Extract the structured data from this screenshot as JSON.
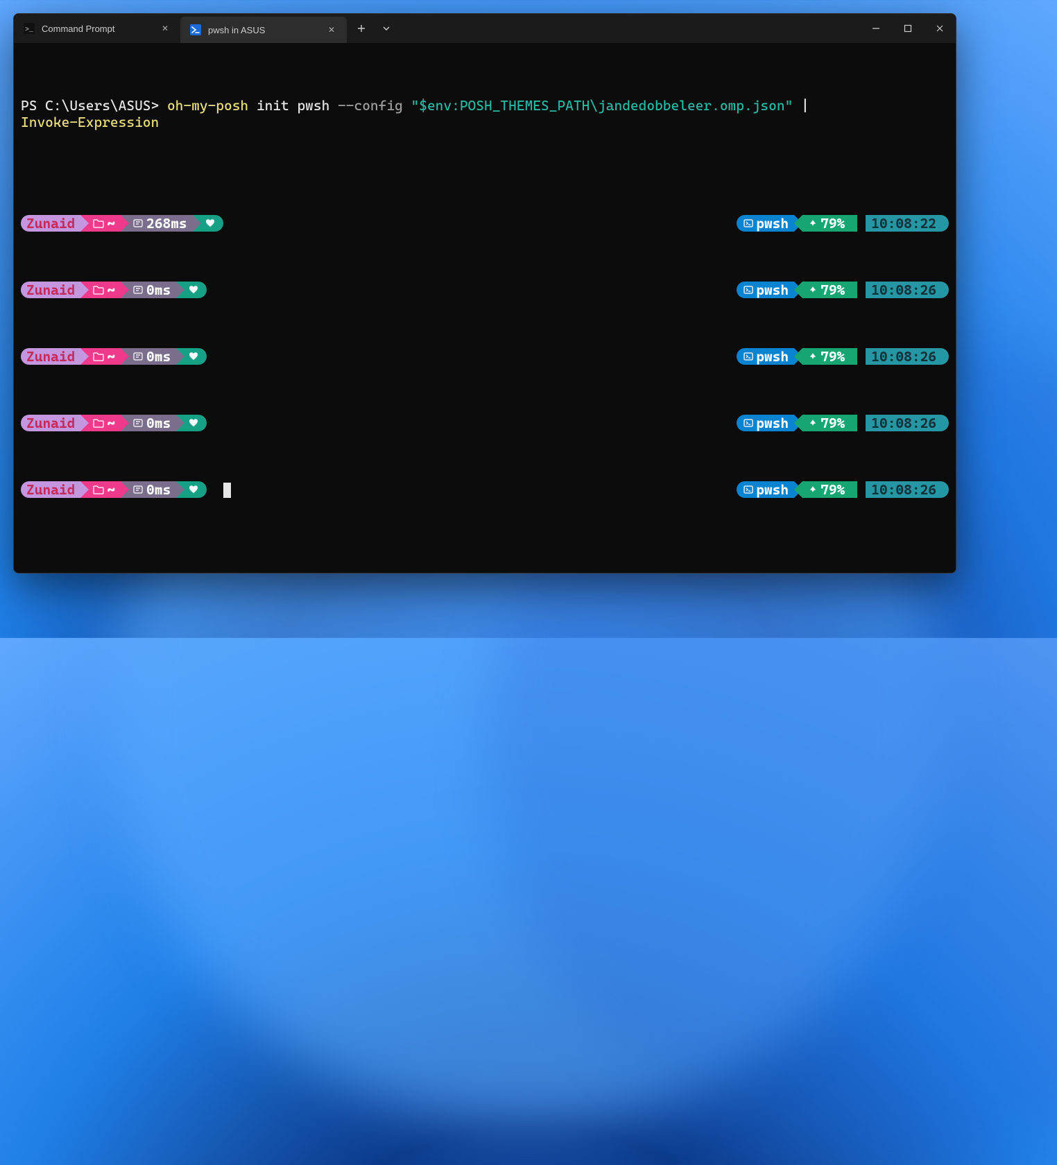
{
  "window": {
    "tabs": [
      {
        "label": "Command Prompt",
        "active": false
      },
      {
        "label": "pwsh in ASUS",
        "active": true
      }
    ],
    "controls": {
      "new_tab": "+",
      "dropdown": "⌄",
      "minimize": "—",
      "maximize": "▢",
      "close": "✕"
    }
  },
  "command": {
    "prompt": "PS C:\\Users\\ASUS> ",
    "cmd": "oh-my-posh",
    "arg1": " init pwsh ",
    "flag": "--config",
    "space": " ",
    "quote1": "\"",
    "str": "$env:POSH_THEMES_PATH\\jandedobbeleer.omp.json",
    "quote2": "\"",
    "pipe": " | ",
    "invoke": "Invoke-Expression"
  },
  "rows": [
    {
      "user": "Zunaid",
      "path": "~",
      "dur": "268ms",
      "pwsh": "pwsh",
      "bat": "79%",
      "time": "10:08:22",
      "cursor": false
    },
    {
      "user": "Zunaid",
      "path": "~",
      "dur": "0ms",
      "pwsh": "pwsh",
      "bat": "79%",
      "time": "10:08:26",
      "cursor": false
    },
    {
      "user": "Zunaid",
      "path": "~",
      "dur": "0ms",
      "pwsh": "pwsh",
      "bat": "79%",
      "time": "10:08:26",
      "cursor": false
    },
    {
      "user": "Zunaid",
      "path": "~",
      "dur": "0ms",
      "pwsh": "pwsh",
      "bat": "79%",
      "time": "10:08:26",
      "cursor": false
    },
    {
      "user": "Zunaid",
      "path": "~",
      "dur": "0ms",
      "pwsh": "pwsh",
      "bat": "79%",
      "time": "10:08:26",
      "cursor": true
    }
  ],
  "icons": {
    "folder": "folder",
    "stopwatch": "stopwatch",
    "heart": "heart",
    "terminal": "terminal",
    "leaf": "leaf"
  }
}
